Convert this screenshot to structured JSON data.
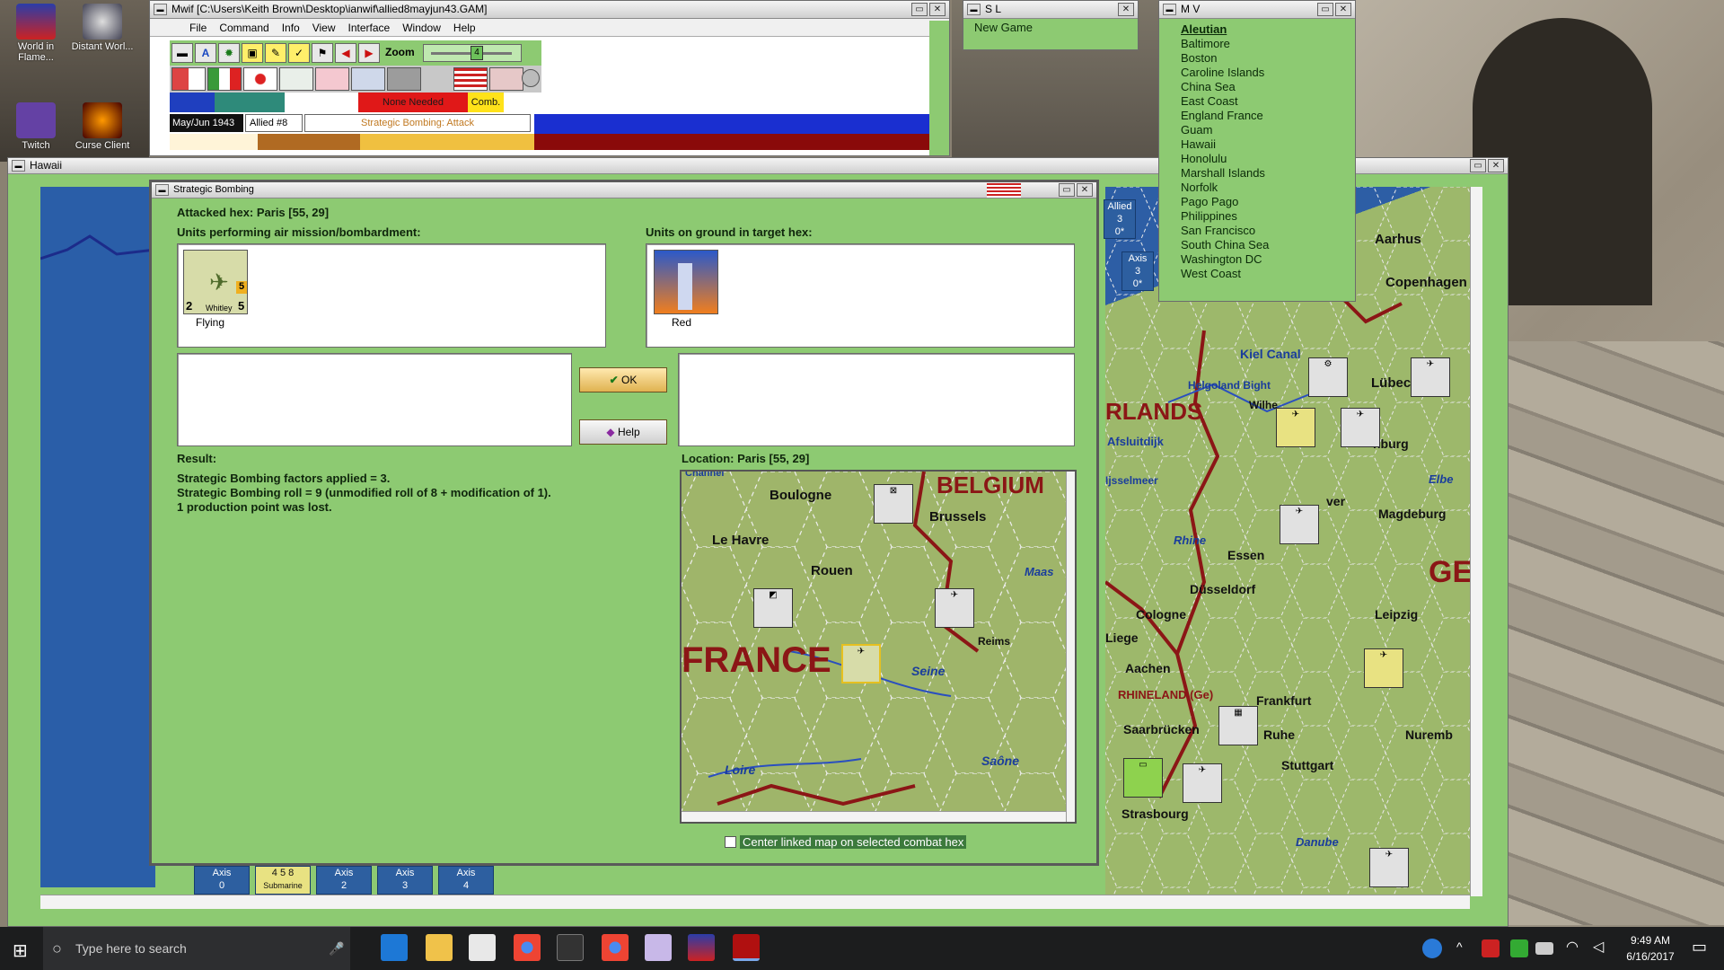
{
  "desktop": {
    "icons": [
      {
        "label": "World in Flame..."
      },
      {
        "label": "Distant Worl..."
      },
      {
        "label": "Twitch"
      },
      {
        "label": "Curse Client"
      }
    ]
  },
  "main_window": {
    "title": "Mwif [C:\\Users\\Keith Brown\\Desktop\\ianwif\\allied8mayjun43.GAM]",
    "menu": [
      "File",
      "Command",
      "Info",
      "View",
      "Interface",
      "Window",
      "Help"
    ],
    "zoom_label": "Zoom",
    "zoom_value": "4",
    "none_needed": "None Needed",
    "comb": "Comb.",
    "date": "May/Jun 1943",
    "impulse": "Allied #8",
    "phase": "Strategic Bombing: Attack"
  },
  "sl_window": {
    "title": "S L",
    "item": "New Game"
  },
  "mv_window": {
    "title": "M V",
    "items": [
      "Aleutian",
      "Baltimore",
      "Boston",
      "Caroline Islands",
      "China Sea",
      "East Coast",
      "England France",
      "Guam",
      "Hawaii",
      "Honolulu",
      "Marshall Islands",
      "Norfolk",
      "Pago Pago",
      "Philippines",
      "San Francisco",
      "South China Sea",
      "Washington DC",
      "West Coast"
    ]
  },
  "map_window": {
    "title": "Hawaii",
    "city_labels": [
      "Aarhus",
      "Copenhagen",
      "Kiel Canal",
      "Lübeck",
      "Helgoland Bight",
      "RLANDS",
      "Wilhe",
      "Afsluitdijk",
      "Ijsselmeer",
      "Rhine",
      "Essen",
      "Magdeburg",
      "Elbe",
      "Düsseldorf",
      "Leipzig",
      "Cologne",
      "Liege",
      "Aachen",
      "RHINELAND (Ge)",
      "Frankfurt",
      "Saarbrücken",
      "Ruhe",
      "Nuremb",
      "Stuttgart",
      "Strasbourg",
      "Danube",
      "GE",
      "nburg",
      "ver"
    ],
    "axis_boxes": [
      {
        "label": "Axis",
        "value": "0"
      },
      {
        "label": "4 5 8",
        "value": "Submarine"
      },
      {
        "label": "Axis",
        "value": "2"
      },
      {
        "label": "Axis",
        "value": "3"
      },
      {
        "label": "Axis",
        "value": "4"
      }
    ],
    "side_labels": [
      {
        "label": "Allied",
        "value": "3",
        "sub": "0*"
      },
      {
        "label": "Axis",
        "value": "3",
        "sub": "0*"
      }
    ]
  },
  "dialog": {
    "title": "Strategic Bombing",
    "attacked_hex": "Attacked hex: Paris  [55, 29]",
    "air_units_label": "Units performing air mission/bombardment:",
    "ground_units_label": "Units on ground in target hex:",
    "air_unit": {
      "name": "Whitley",
      "left": "2",
      "right": "5",
      "top": "5",
      "status": "Flying"
    },
    "ground_unit": {
      "status": "Red"
    },
    "ok_label": "OK",
    "help_label": "Help",
    "result_label": "Result:",
    "result_lines": [
      "Strategic Bombing factors applied = 3.",
      "Strategic Bombing roll = 9 (unmodified roll of 8 + modification of 1).",
      "1 production point was lost."
    ],
    "location_label": "Location:  Paris  [55, 29]",
    "map_labels": [
      "BELGIUM",
      "Boulogne",
      "Brussels",
      "Le Havre",
      "Rouen",
      "Maas",
      "Reims",
      "FRANCE",
      "Seine",
      "Loire",
      "Saône",
      "Channel"
    ],
    "center_checkbox": "Center linked map on selected combat hex"
  },
  "taskbar": {
    "search_placeholder": "Type here to search",
    "time": "9:49 AM",
    "date": "6/16/2017"
  }
}
